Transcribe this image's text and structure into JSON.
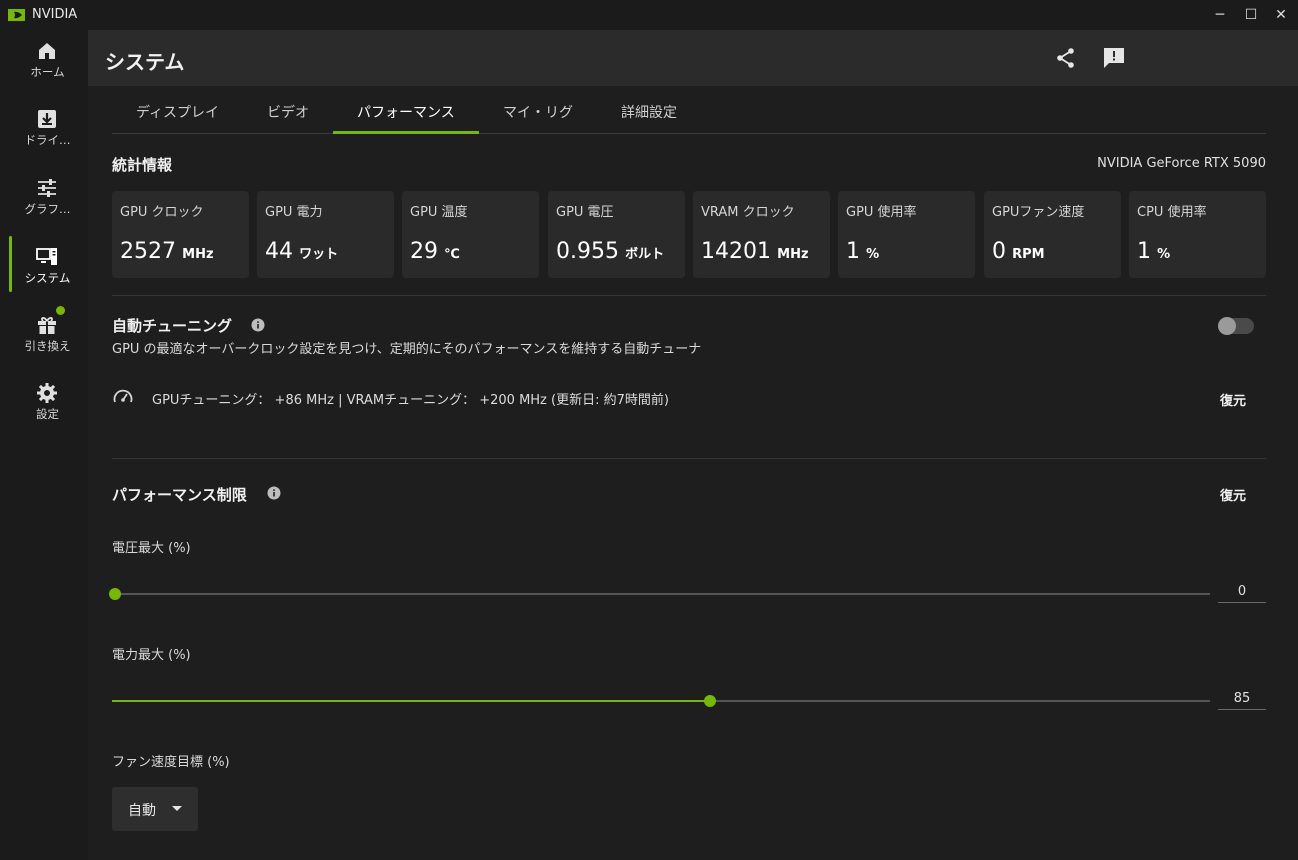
{
  "window": {
    "title": "NVIDIA",
    "minimize": "─",
    "maximize": "☐",
    "close": "✕"
  },
  "sidebar": {
    "items": [
      {
        "label": "ホーム",
        "icon": "home-icon"
      },
      {
        "label": "ドライ…",
        "icon": "driver-download-icon"
      },
      {
        "label": "グラフ…",
        "icon": "sliders-icon"
      },
      {
        "label": "システム",
        "icon": "system-icon",
        "active": true
      },
      {
        "label": "引き換え",
        "icon": "gift-icon",
        "notification": true
      },
      {
        "label": "設定",
        "icon": "gear-icon"
      }
    ]
  },
  "header": {
    "title": "システム"
  },
  "tabs": [
    {
      "label": "ディスプレイ"
    },
    {
      "label": "ビデオ"
    },
    {
      "label": "パフォーマンス",
      "active": true
    },
    {
      "label": "マイ・リグ"
    },
    {
      "label": "詳細設定"
    }
  ],
  "stats": {
    "title": "統計情報",
    "gpu_name": "NVIDIA GeForce RTX 5090",
    "cards": [
      {
        "label": "GPU クロック",
        "value": "2527",
        "unit": "MHz"
      },
      {
        "label": "GPU 電力",
        "value": "44",
        "unit": "ワット"
      },
      {
        "label": "GPU 温度",
        "value": "29",
        "unit": "℃"
      },
      {
        "label": "GPU 電圧",
        "value": "0.955",
        "unit": "ボルト"
      },
      {
        "label": "VRAM クロック",
        "value": "14201",
        "unit": "MHz"
      },
      {
        "label": "GPU 使用率",
        "value": "1",
        "unit": "%"
      },
      {
        "label": "GPUファン速度",
        "value": "0",
        "unit": "RPM"
      },
      {
        "label": "CPU 使用率",
        "value": "1",
        "unit": "%"
      }
    ]
  },
  "auto_tuning": {
    "title": "自動チューニング",
    "description": "GPU の最適なオーバークロック設定を見つけ、定期的にそのパフォーマンスを維持する自動チューナ",
    "enabled": false,
    "result": "GPUチューニング： +86 MHz   |  VRAMチューニング： +200 MHz (更新日: 約7時間前)",
    "restore_label": "復元"
  },
  "perf_limits": {
    "title": "パフォーマンス制限",
    "restore_label": "復元",
    "voltage": {
      "label": "電圧最大 (%)",
      "value": "0",
      "fraction": 0.0
    },
    "power": {
      "label": "電力最大 (%)",
      "value": "85",
      "fraction": 0.545
    },
    "fan": {
      "label": "ファン速度目標 (%)",
      "selected": "自動"
    }
  },
  "colors": {
    "accent": "#76b900",
    "background": "#1e1e1e",
    "card": "#2a2a2a"
  }
}
